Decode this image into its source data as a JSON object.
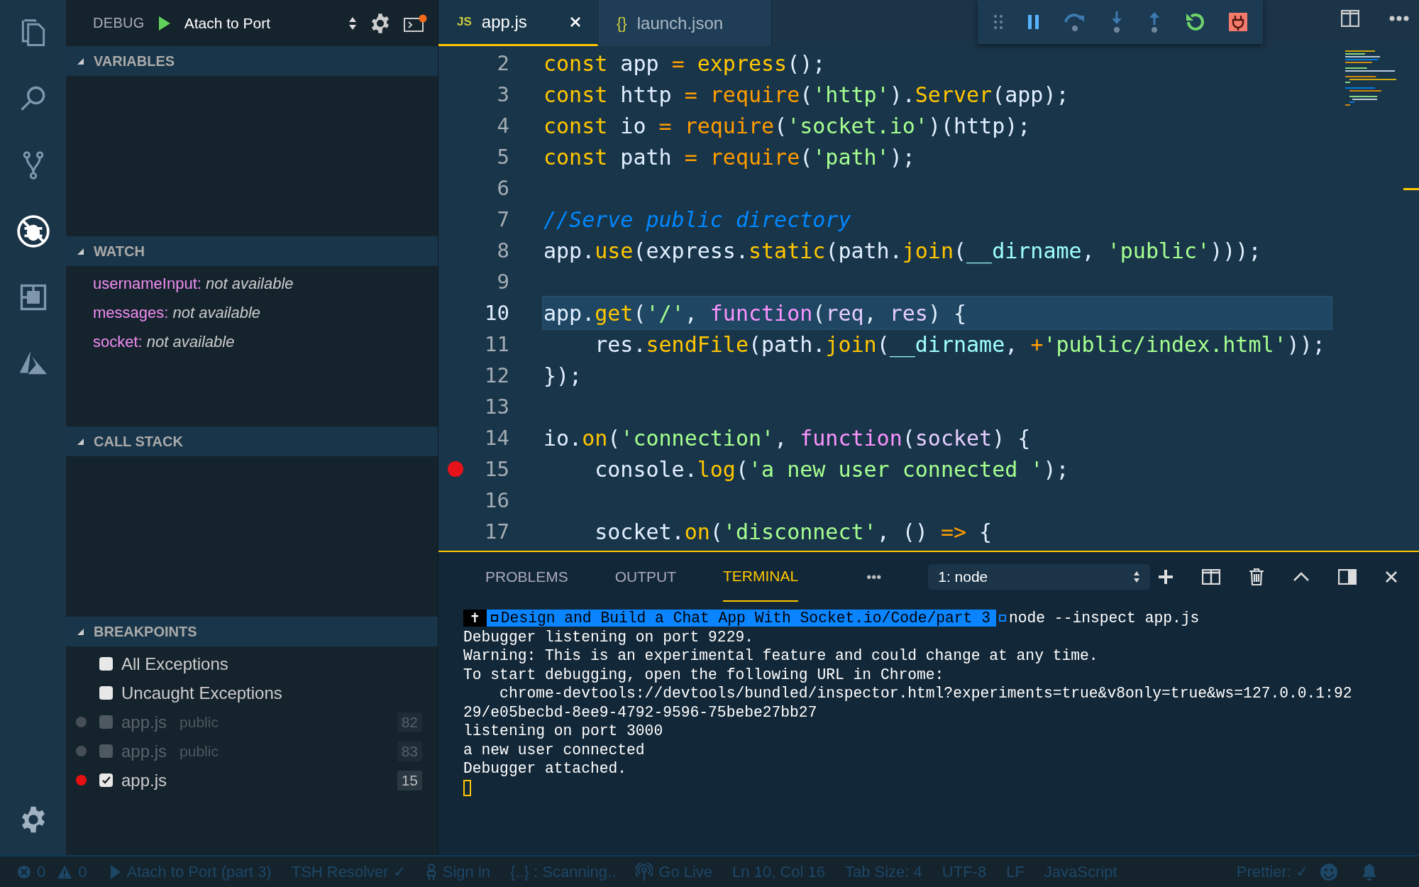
{
  "activity_bar": {
    "items": [
      {
        "kind": "files",
        "selected": false
      },
      {
        "kind": "search",
        "selected": false
      },
      {
        "kind": "branch",
        "selected": false
      },
      {
        "kind": "debug",
        "selected": true
      },
      {
        "kind": "extensions",
        "selected": false
      },
      {
        "kind": "triangle",
        "selected": false
      }
    ]
  },
  "sidebar": {
    "title": "DEBUG",
    "configuration": "Atach to Port",
    "sections": [
      {
        "kind": "variables",
        "title": "VARIABLES",
        "expanded": true
      },
      {
        "kind": "watch",
        "title": "WATCH",
        "expanded": true,
        "items": [
          {
            "name": "usernameInput:",
            "value": "not available"
          },
          {
            "name": "messages:",
            "value": "not available"
          },
          {
            "name": "socket:",
            "value": "not available"
          }
        ]
      },
      {
        "kind": "callstack",
        "title": "CALL STACK",
        "expanded": true
      },
      {
        "kind": "breakpoints",
        "title": "BREAKPOINTS",
        "expanded": true,
        "items": [
          {
            "kind": "exception",
            "label": "All Exceptions",
            "checked": false
          },
          {
            "kind": "exception",
            "label": "Uncaught Exceptions",
            "checked": false
          },
          {
            "kind": "file",
            "label": "app.js",
            "detail": "public",
            "line": "82",
            "checked": false,
            "enabled": false
          },
          {
            "kind": "file",
            "label": "app.js",
            "detail": "public",
            "line": "83",
            "checked": false,
            "enabled": false
          },
          {
            "kind": "file",
            "label": "app.js",
            "line": "15",
            "checked": true,
            "enabled": true
          }
        ]
      }
    ]
  },
  "editor": {
    "tabs": [
      {
        "badge": "JS",
        "label": "app.js",
        "selected": true
      },
      {
        "badge": "{}",
        "label": "launch.json",
        "selected": false
      }
    ],
    "lines": [
      {
        "number": "2",
        "current": false,
        "breakpoint": false,
        "tokens": [
          {
            "text": "const",
            "kind": "kw"
          },
          {
            "text": " app ",
            "kind": "id"
          },
          {
            "text": "= ",
            "kind": "op"
          },
          {
            "text": "express",
            "kind": "fn"
          },
          {
            "text": "();",
            "kind": "p"
          }
        ]
      },
      {
        "number": "3",
        "current": false,
        "breakpoint": false,
        "tokens": [
          {
            "text": "const",
            "kind": "kw"
          },
          {
            "text": " http ",
            "kind": "id"
          },
          {
            "text": "= ",
            "kind": "op"
          },
          {
            "text": "require",
            "kind": "req"
          },
          {
            "text": "(",
            "kind": "p"
          },
          {
            "text": "'http'",
            "kind": "str"
          },
          {
            "text": ").",
            "kind": "p"
          },
          {
            "text": "Server",
            "kind": "fn"
          },
          {
            "text": "(app);",
            "kind": "p"
          }
        ]
      },
      {
        "number": "4",
        "current": false,
        "breakpoint": false,
        "tokens": [
          {
            "text": "const",
            "kind": "kw"
          },
          {
            "text": " io ",
            "kind": "id"
          },
          {
            "text": "= ",
            "kind": "op"
          },
          {
            "text": "require",
            "kind": "req"
          },
          {
            "text": "(",
            "kind": "p"
          },
          {
            "text": "'socket.io'",
            "kind": "str"
          },
          {
            "text": ")(http);",
            "kind": "p"
          }
        ]
      },
      {
        "number": "5",
        "current": false,
        "breakpoint": false,
        "tokens": [
          {
            "text": "const",
            "kind": "kw"
          },
          {
            "text": " path ",
            "kind": "id"
          },
          {
            "text": "= ",
            "kind": "op"
          },
          {
            "text": "require",
            "kind": "req"
          },
          {
            "text": "(",
            "kind": "p"
          },
          {
            "text": "'path'",
            "kind": "str"
          },
          {
            "text": ");",
            "kind": "p"
          }
        ]
      },
      {
        "number": "6",
        "current": false,
        "breakpoint": false
      },
      {
        "number": "7",
        "current": false,
        "breakpoint": false,
        "tokens": [
          {
            "text": "//Serve public directory",
            "kind": "cmt"
          }
        ]
      },
      {
        "number": "8",
        "current": false,
        "breakpoint": false,
        "tokens": [
          {
            "text": "app.",
            "kind": "id"
          },
          {
            "text": "use",
            "kind": "fn"
          },
          {
            "text": "(express.",
            "kind": "p"
          },
          {
            "text": "static",
            "kind": "fn"
          },
          {
            "text": "(path.",
            "kind": "p"
          },
          {
            "text": "join",
            "kind": "fn"
          },
          {
            "text": "(",
            "kind": "p"
          },
          {
            "text": "__dirname",
            "kind": "dn"
          },
          {
            "text": ", ",
            "kind": "p"
          },
          {
            "text": "'public'",
            "kind": "str"
          },
          {
            "text": ")));",
            "kind": "p"
          }
        ]
      },
      {
        "number": "9",
        "current": false,
        "breakpoint": false
      },
      {
        "number": "10",
        "current": true,
        "breakpoint": false,
        "tokens": [
          {
            "text": "app.",
            "kind": "id"
          },
          {
            "text": "get",
            "kind": "fn"
          },
          {
            "text": "(",
            "kind": "p"
          },
          {
            "text": "'/'",
            "kind": "str"
          },
          {
            "text": ", ",
            "kind": "p"
          },
          {
            "text": "function",
            "kind": "func"
          },
          {
            "text": "(",
            "kind": "p"
          },
          {
            "text": "req",
            "kind": "param"
          },
          {
            "text": ", ",
            "kind": "p"
          },
          {
            "text": "res",
            "kind": "param"
          },
          {
            "text": ") {",
            "kind": "p"
          }
        ]
      },
      {
        "number": "11",
        "current": false,
        "breakpoint": false,
        "tokens": [
          {
            "text": "    res.",
            "kind": "id"
          },
          {
            "text": "sendFile",
            "kind": "fn"
          },
          {
            "text": "(path.",
            "kind": "p"
          },
          {
            "text": "join",
            "kind": "fn"
          },
          {
            "text": "(",
            "kind": "p"
          },
          {
            "text": "__dirname",
            "kind": "dn"
          },
          {
            "text": ", ",
            "kind": "p"
          },
          {
            "text": "+",
            "kind": "op"
          },
          {
            "text": "'public/index.html'",
            "kind": "str"
          },
          {
            "text": "));",
            "kind": "p"
          }
        ]
      },
      {
        "number": "12",
        "current": false,
        "breakpoint": false,
        "tokens": [
          {
            "text": "});",
            "kind": "p"
          }
        ]
      },
      {
        "number": "13",
        "current": false,
        "breakpoint": false
      },
      {
        "number": "14",
        "current": false,
        "breakpoint": false,
        "tokens": [
          {
            "text": "io.",
            "kind": "id"
          },
          {
            "text": "on",
            "kind": "fn"
          },
          {
            "text": "(",
            "kind": "p"
          },
          {
            "text": "'connection'",
            "kind": "str"
          },
          {
            "text": ", ",
            "kind": "p"
          },
          {
            "text": "function",
            "kind": "func"
          },
          {
            "text": "(",
            "kind": "p"
          },
          {
            "text": "socket",
            "kind": "param"
          },
          {
            "text": ") {",
            "kind": "p"
          }
        ]
      },
      {
        "number": "15",
        "current": false,
        "breakpoint": true,
        "tokens": [
          {
            "text": "    console.",
            "kind": "id"
          },
          {
            "text": "log",
            "kind": "fn"
          },
          {
            "text": "(",
            "kind": "p"
          },
          {
            "text": "'a new user connected '",
            "kind": "str"
          },
          {
            "text": ");",
            "kind": "p"
          }
        ]
      },
      {
        "number": "16",
        "current": false,
        "breakpoint": false
      },
      {
        "number": "17",
        "current": false,
        "breakpoint": false,
        "tokens": [
          {
            "text": "    socket.",
            "kind": "id"
          },
          {
            "text": "on",
            "kind": "fn"
          },
          {
            "text": "(",
            "kind": "p"
          },
          {
            "text": "'disconnect'",
            "kind": "str"
          },
          {
            "text": ", () ",
            "kind": "p"
          },
          {
            "text": "=>",
            "kind": "op"
          },
          {
            "text": " {",
            "kind": "p"
          }
        ]
      }
    ]
  },
  "panel": {
    "tabs": [
      {
        "label": "PROBLEMS",
        "selected": false
      },
      {
        "label": "OUTPUT",
        "selected": false
      },
      {
        "label": "TERMINAL",
        "selected": true
      }
    ],
    "more": "•••",
    "terminal_selector": "1: node",
    "terminal": {
      "prompt_symbol": "✝",
      "prompt_path": "Design and Build a Chat App With Socket.io/Code/part 3",
      "command": "node --inspect app.js",
      "lines": [
        "Debugger listening on port 9229.",
        "Warning: This is an experimental feature and could change at any time.",
        "To start debugging, open the following URL in Chrome:",
        "    chrome-devtools://devtools/bundled/inspector.html?experiments=true&v8only=true&ws=127.0.0.1:92",
        "29/e05becbd-8ee9-4792-9596-75bebe27bb27",
        "listening on port 3000",
        "a new user connected",
        "Debugger attached."
      ]
    }
  },
  "status_bar": {
    "left": [
      {
        "kind": "error",
        "text": "0"
      },
      {
        "kind": "warning",
        "text": "0"
      },
      {
        "kind": "play",
        "text": "Atach to Port (part 3)"
      },
      {
        "kind": "plain",
        "text": "TSH Resolver ✓"
      },
      {
        "kind": "person",
        "text": "Sign in"
      },
      {
        "kind": "plain",
        "text": "{..} : Scanning.."
      },
      {
        "kind": "broadcast",
        "text": "Go Live"
      },
      {
        "kind": "plain",
        "text": "Ln 10, Col 16"
      },
      {
        "kind": "plain",
        "text": "Tab Size: 4"
      },
      {
        "kind": "plain",
        "text": "UTF-8"
      },
      {
        "kind": "plain",
        "text": "LF"
      },
      {
        "kind": "plain",
        "text": "JavaScript"
      }
    ],
    "right": [
      {
        "kind": "plain",
        "text": "Prettier: ✓"
      },
      {
        "kind": "smiley"
      },
      {
        "kind": "bell"
      }
    ]
  }
}
